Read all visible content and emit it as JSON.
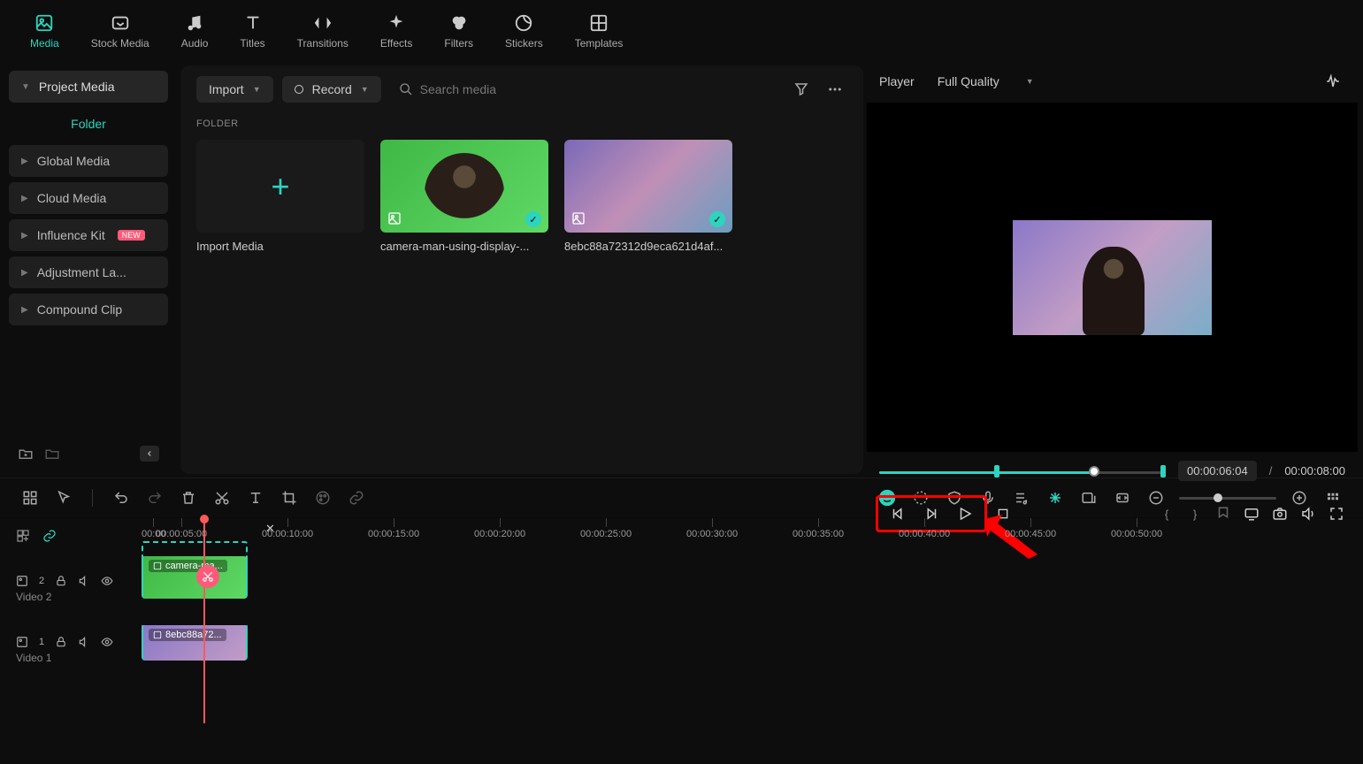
{
  "nav": {
    "items": [
      {
        "label": "Media"
      },
      {
        "label": "Stock Media"
      },
      {
        "label": "Audio"
      },
      {
        "label": "Titles"
      },
      {
        "label": "Transitions"
      },
      {
        "label": "Effects"
      },
      {
        "label": "Filters"
      },
      {
        "label": "Stickers"
      },
      {
        "label": "Templates"
      }
    ]
  },
  "sidebar": {
    "items": [
      {
        "label": "Project Media"
      },
      {
        "label": "Folder"
      },
      {
        "label": "Global Media"
      },
      {
        "label": "Cloud Media"
      },
      {
        "label": "Influence Kit",
        "badge": "NEW"
      },
      {
        "label": "Adjustment La..."
      },
      {
        "label": "Compound Clip"
      }
    ]
  },
  "mediaPanel": {
    "import_label": "Import",
    "record_label": "Record",
    "search_placeholder": "Search media",
    "folder_label": "FOLDER",
    "cards": [
      {
        "caption": "Import Media"
      },
      {
        "caption": "camera-man-using-display-..."
      },
      {
        "caption": "8ebc88a72312d9eca621d4af..."
      }
    ]
  },
  "player": {
    "title": "Player",
    "quality": "Full Quality",
    "current_time": "00:00:06:04",
    "total_time": "00:00:08:00"
  },
  "ruler": {
    "ticks": [
      "00:00",
      "00:00:05:00",
      "00:00:10:00",
      "00:00:15:00",
      "00:00:20:00",
      "00:00:25:00",
      "00:00:30:00",
      "00:00:35:00",
      "00:00:40:00",
      "00:00:45:00",
      "00:00:50:00"
    ]
  },
  "tracks": [
    {
      "name": "Video 2",
      "count": "2",
      "clip_label": "camera-ma..."
    },
    {
      "name": "Video 1",
      "count": "1",
      "clip_label": "8ebc88a72..."
    }
  ]
}
